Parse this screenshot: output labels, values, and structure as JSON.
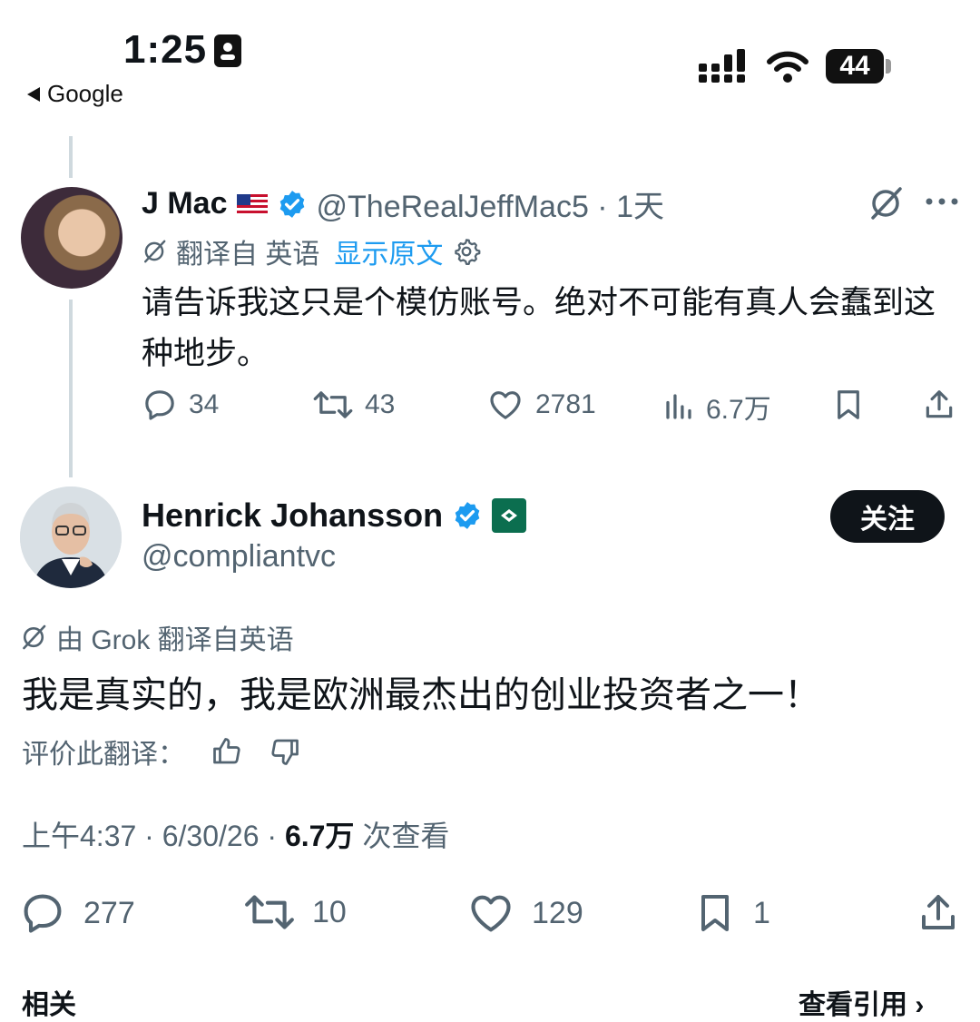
{
  "status_bar": {
    "time": "1:25",
    "back_label": "Google",
    "battery": "44"
  },
  "reply_tweet": {
    "name": "J Mac",
    "handle_time": "@TheRealJeffMac5 · 1天",
    "translate_label": "翻译自 英语",
    "show_original": "显示原文",
    "text": "请告诉我这只是个模仿账号。绝对不可能有真人会蠢到这种地步。",
    "actions": {
      "replies": "34",
      "retweets": "43",
      "likes": "2781",
      "views": "6.7万"
    }
  },
  "main_tweet": {
    "name": "Henrick Johansson",
    "handle": "@compliantvc",
    "follow_label": "关注",
    "grok_label": "由 Grok 翻译自英语",
    "text": "我是真实的，我是欧洲最杰出的创业投资者之一！",
    "rate_label": "评价此翻译：",
    "meta_time": "上午4:37 · 6/30/26 · ",
    "meta_views": "6.7万",
    "meta_views_suffix": " 次查看",
    "actions": {
      "replies": "277",
      "retweets": "10",
      "likes": "129",
      "bookmarks": "1"
    }
  },
  "bottom": {
    "left": "相关",
    "right": "查看引用 ›"
  },
  "colors": {
    "text": "#0f1419",
    "secondary": "#536471",
    "link": "#1d9bf0",
    "verified": "#1d9bf0",
    "thread_line": "#cfd9de"
  }
}
